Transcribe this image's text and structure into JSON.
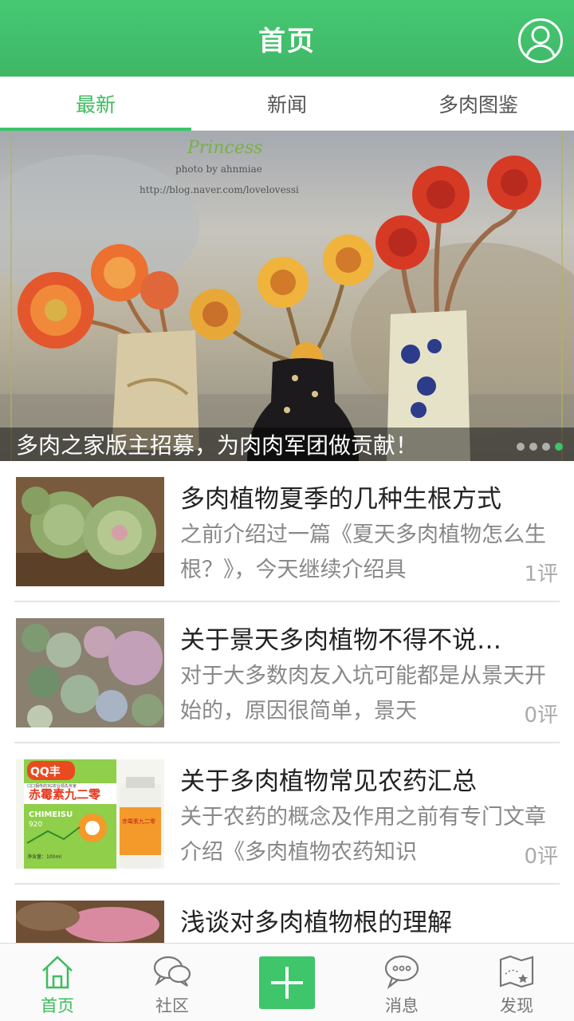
{
  "header": {
    "title": "首页",
    "avatar_icon": "user-avatar-icon"
  },
  "tabs": [
    {
      "label": "最新",
      "active": true
    },
    {
      "label": "新闻",
      "active": false
    },
    {
      "label": "多肉图鉴",
      "active": false
    }
  ],
  "banner": {
    "watermark_title": "Princess",
    "watermark_credit": "photo by ahnmiae",
    "watermark_url": "http://blog.naver.com/lovelovessi",
    "caption": "多肉之家版主招募，为肉肉军团做贡献！",
    "slide_count": 4,
    "active_slide": 4
  },
  "articles": [
    {
      "title": "多肉植物夏季的几种生根方式",
      "summary": "之前介绍过一篇《夏天多肉植物怎么生根？》，今天继续介绍具",
      "comments": "1评"
    },
    {
      "title": "关于景天多肉植物不得不说…",
      "summary": "对于大多数肉友入坑可能都是从景天开始的，原因很简单，景天",
      "comments": "0评"
    },
    {
      "title": "关于多肉植物常见农药汇总",
      "summary": "关于农药的概念及作用之前有专门文章介绍《多肉植物农药知识",
      "comments": "0评",
      "thumb_text": {
        "brand": "QQ丰",
        "name": "赤霉素九二零",
        "latin": "CHIMEISU",
        "code": "920",
        "small": "口口相传的3G农业领先专家",
        "volume": "净含量：100ml",
        "bottle_label": "赤霉素九二零"
      }
    },
    {
      "title": "浅谈对多肉植物根的理解",
      "summary": "",
      "comments": ""
    }
  ],
  "bottom_nav": [
    {
      "label": "首页",
      "icon": "home-icon",
      "active": true
    },
    {
      "label": "社区",
      "icon": "chat-bubbles-icon",
      "active": false
    },
    {
      "label": "",
      "icon": "plus-icon",
      "active": false
    },
    {
      "label": "消息",
      "icon": "message-icon",
      "active": false
    },
    {
      "label": "发现",
      "icon": "map-icon",
      "active": false
    }
  ],
  "colors": {
    "brand_green": "#3fb766",
    "accent_green": "#3cc36a"
  }
}
